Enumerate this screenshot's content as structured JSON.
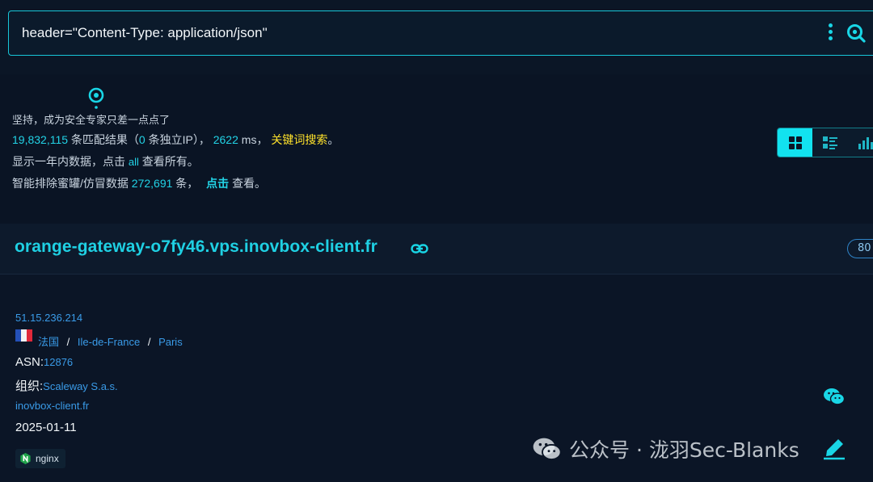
{
  "search": {
    "query": "header=\"Content-Type: application/json\"",
    "more_icon": "kebab-icon",
    "submit_icon": "search-icon"
  },
  "summary": {
    "motto": "坚持，成为安全专家只差一点点了",
    "match_count": "19,832,115",
    "match_text": "条匹配结果（",
    "ip_count": "0",
    "ip_text": "条独立IP），",
    "time_ms": "2622",
    "time_unit": "ms，",
    "keyword_search": "关键词搜索",
    "period_end": "。",
    "year_prefix": "显示一年内数据，点击",
    "all_link": "all",
    "year_suffix": "查看所有。",
    "honeypot_prefix": "智能排除蜜罐/仿冒数据",
    "honeypot_count": "272,691",
    "honeypot_unit": "条，",
    "click_link": "点击",
    "honeypot_suffix": "查看。"
  },
  "views": {
    "items": [
      "grid-view",
      "list-view",
      "stats-view"
    ],
    "active": "grid-view"
  },
  "result": {
    "hostname": "orange-gateway-o7fy46.vps.inovbox-client.fr",
    "port": "80",
    "ip": "51.15.236.214",
    "country": "法国",
    "region": "Ile-de-France",
    "city": "Paris",
    "sep": "/",
    "asn_label": "ASN:",
    "asn": "12876",
    "org_label": "组织:",
    "org": "Scaleway S.a.s.",
    "domain": "inovbox-client.fr",
    "date": "2025-01-11",
    "tag": "nginx"
  },
  "watermark": {
    "text": "公众号 · 泷羽Sec-Blanks"
  },
  "colors": {
    "accent": "#1fd0e3",
    "highlight": "#ffe22b",
    "link": "#3a9be8",
    "background": "#0a1424"
  }
}
